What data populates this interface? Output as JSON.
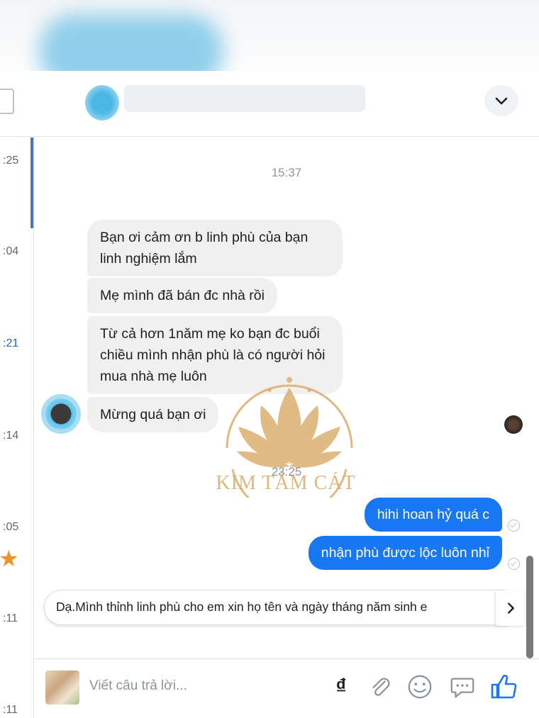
{
  "left_list": {
    "times": [
      ":25",
      ":04",
      ":21",
      ":14",
      ":05",
      ":11",
      ":11"
    ]
  },
  "chat": {
    "timestamp_1": "15:37",
    "incoming": [
      "Bạn ơi cảm ơn b linh phù của bạn linh nghiệm lắm",
      "Mẹ mình đã bán đc nhà rồi",
      "Từ cả hơn 1năm mẹ ko bạn đc buổi chiều mình nhận phù là có người hỏi mua nhà mẹ luôn",
      "Mừng quá bạn ơi"
    ],
    "timestamp_2": "23:25",
    "outgoing": [
      "hihi hoan hỷ quá c",
      "nhận phù được lộc luôn nhỉ"
    ]
  },
  "watermark": {
    "text": "KIM TÂM CÁT",
    "color": "#d9ae6a"
  },
  "quick_reply": {
    "text": "Dạ.Mình thỉnh linh phù cho em xin họ tên và ngày tháng năm sinh e"
  },
  "composer": {
    "placeholder": "Viết câu trả lời...",
    "currency_symbol": "₫"
  },
  "colors": {
    "outgoing_bubble": "#1877f2",
    "incoming_bubble": "#f1f0f0",
    "like_icon": "#1877f2"
  }
}
